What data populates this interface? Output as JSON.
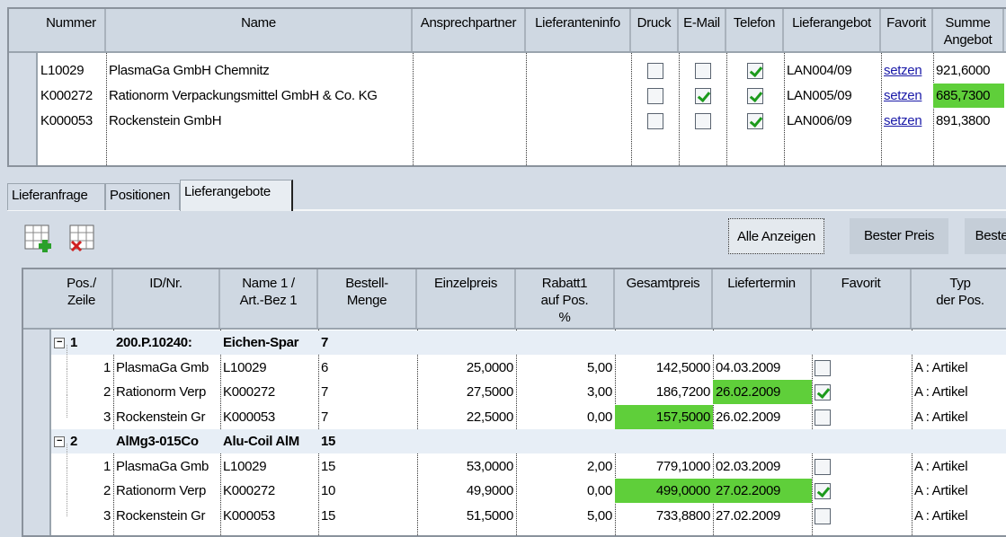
{
  "suppliers": {
    "columns": [
      "Nummer",
      "Name",
      "Ansprechpartner",
      "Lieferanteninfo",
      "Druck",
      "E-Mail",
      "Telefon",
      "Lieferangebot",
      "Favorit",
      "Summe Angebot"
    ],
    "rows": [
      {
        "nummer": "L10029",
        "name": "PlasmaGa GmbH Chemnitz",
        "druck": false,
        "email": false,
        "telefon": true,
        "angebot": "LAN004/09",
        "favorit": "setzen",
        "summe": "921,6000",
        "best": false
      },
      {
        "nummer": "K000272",
        "name": "Rationorm Verpackungsmittel GmbH & Co. KG",
        "druck": false,
        "email": true,
        "telefon": true,
        "angebot": "LAN005/09",
        "favorit": "setzen",
        "summe": "685,7300",
        "best": true
      },
      {
        "nummer": "K000053",
        "name": "Rockenstein GmbH",
        "druck": false,
        "email": false,
        "telefon": true,
        "angebot": "LAN006/09",
        "favorit": "setzen",
        "summe": "891,3800",
        "best": false
      }
    ]
  },
  "tabs": [
    "Lieferanfrage",
    "Positionen",
    "Lieferangebote"
  ],
  "active_tab": 2,
  "toolbar": {
    "add_icon": "grid-add-icon",
    "delete_icon": "grid-delete-icon",
    "buttons": [
      "Alle Anzeigen",
      "Bester Preis",
      "Beste"
    ]
  },
  "colors": {
    "highlight": "#5fcf3a"
  },
  "offers": {
    "columns": [
      "Pos./\nZeile",
      "ID/Nr.",
      "Name 1 /\nArt.-Bez 1",
      "Bestell-\nMenge",
      "Einzelpreis",
      "Rabatt1\nauf Pos.\n%",
      "Gesamtpreis",
      "Liefertermin",
      "Favorit",
      "Typ\nder Pos."
    ],
    "groups": [
      {
        "pos": "1",
        "id": "200.P.10240:",
        "name": "Eichen-Spar",
        "menge": "7",
        "rows": [
          {
            "zeile": "1",
            "id": "PlasmaGa Gmb",
            "name": "L10029",
            "menge": "6",
            "einzel": "25,0000",
            "rabatt": "5,00",
            "gesamt": "142,5000",
            "termin": "04.03.2009",
            "fav": false,
            "typ": "A : Artikel",
            "bestPrice": false,
            "bestDate": false
          },
          {
            "zeile": "2",
            "id": "Rationorm Verp",
            "name": "K000272",
            "menge": "7",
            "einzel": "27,5000",
            "rabatt": "3,00",
            "gesamt": "186,7200",
            "termin": "26.02.2009",
            "fav": true,
            "typ": "A : Artikel",
            "bestPrice": false,
            "bestDate": true
          },
          {
            "zeile": "3",
            "id": "Rockenstein Gr",
            "name": "K000053",
            "menge": "7",
            "einzel": "22,5000",
            "rabatt": "0,00",
            "gesamt": "157,5000",
            "termin": "26.02.2009",
            "fav": false,
            "typ": "A : Artikel",
            "bestPrice": true,
            "bestDate": false
          }
        ]
      },
      {
        "pos": "2",
        "id": "AlMg3-015Co",
        "name": "Alu-Coil AlM",
        "menge": "15",
        "rows": [
          {
            "zeile": "1",
            "id": "PlasmaGa Gmb",
            "name": "L10029",
            "menge": "15",
            "einzel": "53,0000",
            "rabatt": "2,00",
            "gesamt": "779,1000",
            "termin": "02.03.2009",
            "fav": false,
            "typ": "A : Artikel",
            "bestPrice": false,
            "bestDate": false
          },
          {
            "zeile": "2",
            "id": "Rationorm Verp",
            "name": "K000272",
            "menge": "10",
            "einzel": "49,9000",
            "rabatt": "0,00",
            "gesamt": "499,0000",
            "termin": "27.02.2009",
            "fav": true,
            "typ": "A : Artikel",
            "bestPrice": true,
            "bestDate": true
          },
          {
            "zeile": "3",
            "id": "Rockenstein Gr",
            "name": "K000053",
            "menge": "15",
            "einzel": "51,5000",
            "rabatt": "5,00",
            "gesamt": "733,8800",
            "termin": "27.02.2009",
            "fav": false,
            "typ": "A : Artikel",
            "bestPrice": false,
            "bestDate": false
          }
        ]
      }
    ]
  }
}
